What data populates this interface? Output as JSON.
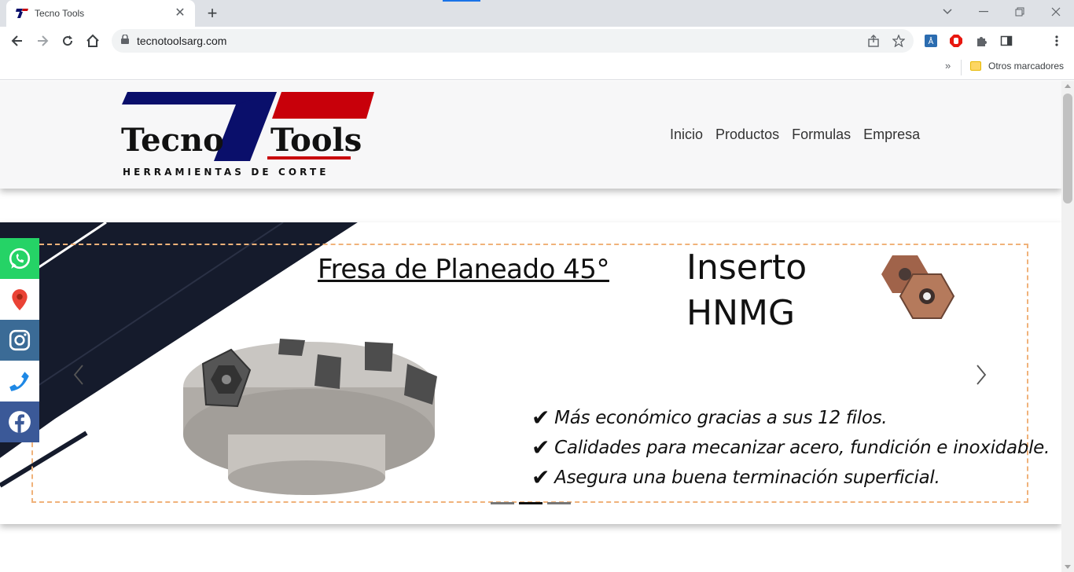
{
  "browser": {
    "tab_title": "Tecno Tools",
    "url": "tecnotoolsarg.com",
    "bookmarks_more": "»",
    "bookmarks_folder": "Otros marcadores",
    "accent_color": "#1a73e8"
  },
  "site": {
    "logo": {
      "word_left": "Tecno",
      "word_right": "Tools",
      "tagline": "HERRAMIENTAS DE CORTE",
      "colors": {
        "blue": "#0a0f6b",
        "red": "#c8000a"
      }
    },
    "nav": [
      "Inicio",
      "Productos",
      "Formulas",
      "Empresa"
    ],
    "slide": {
      "heading": "Fresa de Planeado 45°",
      "title_line1": "Inserto",
      "title_line2": "HNMG",
      "features": [
        "Más económico gracias a sus 12 filos.",
        "Calidades para mecanizar acero, fundición e inoxidable.",
        "Asegura una buena terminación superficial."
      ],
      "check_glyph": "✔"
    },
    "indicator_count": 3,
    "active_indicator": 2,
    "social": [
      {
        "name": "whatsapp-icon",
        "color": "#25d366"
      },
      {
        "name": "map-pin-icon",
        "color": "#ea4335"
      },
      {
        "name": "instagram-icon",
        "color": "#3b6b96"
      },
      {
        "name": "phone-icon",
        "color": "#1e88e5"
      },
      {
        "name": "facebook-icon",
        "color": "#3b5998"
      }
    ]
  }
}
